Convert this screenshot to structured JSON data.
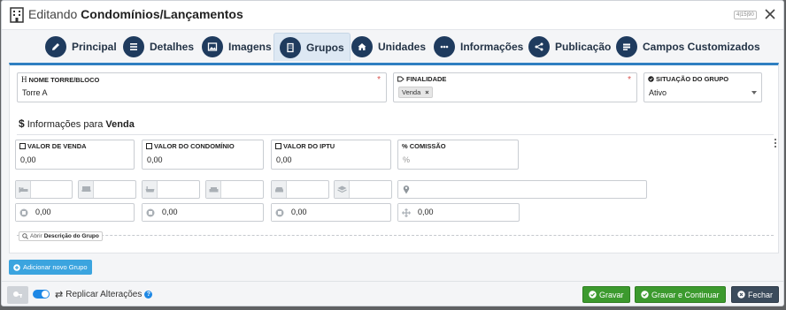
{
  "header": {
    "prefix": "Editando",
    "title": "Condomínios/Lançamentos",
    "counter": "4|15|90"
  },
  "tabs": [
    {
      "label": "Principal",
      "icon": "pencil-icon"
    },
    {
      "label": "Detalhes",
      "icon": "list-icon"
    },
    {
      "label": "Imagens",
      "icon": "image-icon"
    },
    {
      "label": "Grupos",
      "icon": "building-icon",
      "active": true
    },
    {
      "label": "Unidades",
      "icon": "home-icon"
    },
    {
      "label": "Informações",
      "icon": "more-icon"
    },
    {
      "label": "Publicação",
      "icon": "share-icon"
    },
    {
      "label": "Campos Customizados",
      "icon": "fields-icon"
    }
  ],
  "group_form": {
    "nome": {
      "label": "NOME TORRE/BLOCO",
      "value": "Torre A"
    },
    "finalidade": {
      "label": "FINALIDADE",
      "tag": "Venda",
      "tag_remove": "×"
    },
    "situacao": {
      "label": "SITUAÇÃO DO GRUPO",
      "value": "Ativo"
    },
    "required_mark": "*"
  },
  "section": {
    "prefix": "Informações para",
    "bold": "Venda"
  },
  "prices": {
    "venda": {
      "label": "VALOR DE VENDA",
      "value": "0,00"
    },
    "condominio": {
      "label": "VALOR DO CONDOMÍNIO",
      "value": "0,00"
    },
    "iptu": {
      "label": "VALOR DO IPTU",
      "value": "0,00"
    },
    "comissao": {
      "label": "% COMISSÃO",
      "placeholder": "%"
    }
  },
  "area_values": {
    "a1": "0,00",
    "a2": "0,00",
    "a3": "0,00",
    "a4": "0,00"
  },
  "description_pill": {
    "prefix": "Abrir",
    "bold": "Descrição do Grupo"
  },
  "add_group_label": "Adicionar novo Grupo",
  "footer": {
    "replicate_label": "Replicar Alterações",
    "help": "?",
    "save": "Gravar",
    "save_continue": "Gravar e Continuar",
    "close": "Fechar"
  },
  "colors": {
    "accent_blue": "#2f7fc1",
    "tab_icon": "#1f3b5e",
    "save_green": "#3c9a2e",
    "close_dark": "#3b4b5c",
    "add_button": "#3ba4df"
  }
}
